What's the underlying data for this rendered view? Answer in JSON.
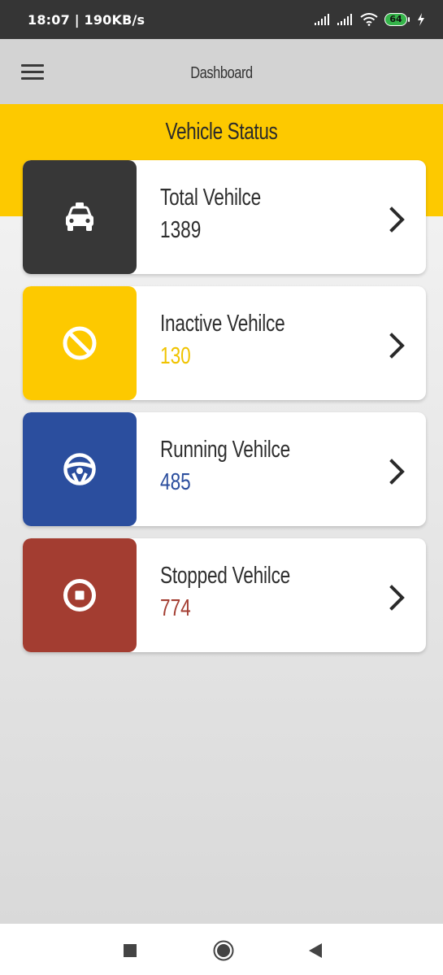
{
  "status_bar": {
    "time": "18:07 | 190KB/s",
    "battery": "64"
  },
  "app_bar": {
    "title": "Dashboard"
  },
  "banner": {
    "title": "Vehicle Status"
  },
  "cards": [
    {
      "label": "Total Vehilce",
      "value": "1389",
      "color": "#373737",
      "value_color": "#2e2e2e",
      "icon": "taxi-icon"
    },
    {
      "label": "Inactive Vehilce",
      "value": "130",
      "color": "#fdc900",
      "value_color": "#f0c300",
      "icon": "ban-icon"
    },
    {
      "label": "Running Vehilce",
      "value": "485",
      "color": "#2b4e9e",
      "value_color": "#2b4e9e",
      "icon": "steering-wheel-icon"
    },
    {
      "label": "Stopped Vehilce",
      "value": "774",
      "color": "#a33d31",
      "value_color": "#a33d31",
      "icon": "stop-circle-icon"
    }
  ]
}
